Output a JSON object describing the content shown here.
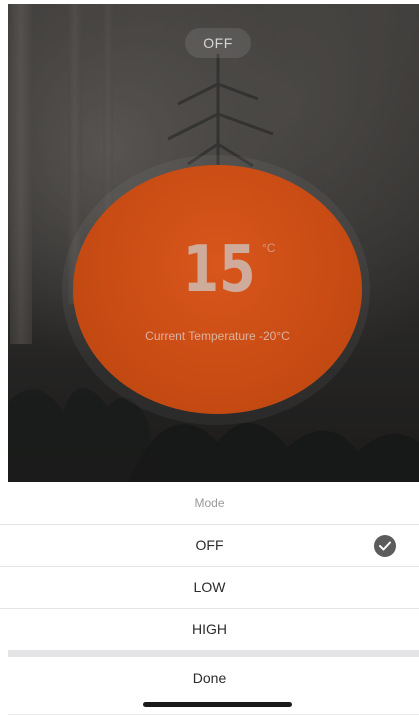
{
  "header": {
    "power_state": "OFF"
  },
  "dial": {
    "set_temperature": "15",
    "unit": "°C",
    "current_temperature_text": "Current Temperature -20°C",
    "color": "#c94c14"
  },
  "mode_sheet": {
    "title": "Mode",
    "options": [
      {
        "label": "OFF",
        "selected": true
      },
      {
        "label": "LOW",
        "selected": false
      },
      {
        "label": "HIGH",
        "selected": false
      }
    ],
    "selected_icon": "checkmark-icon",
    "done_label": "Done"
  },
  "colors": {
    "dial_accent": "#c94c14",
    "check_badge": "#5c5c5c",
    "sheet_background": "#ffffff",
    "divider": "#e5e5e5"
  }
}
